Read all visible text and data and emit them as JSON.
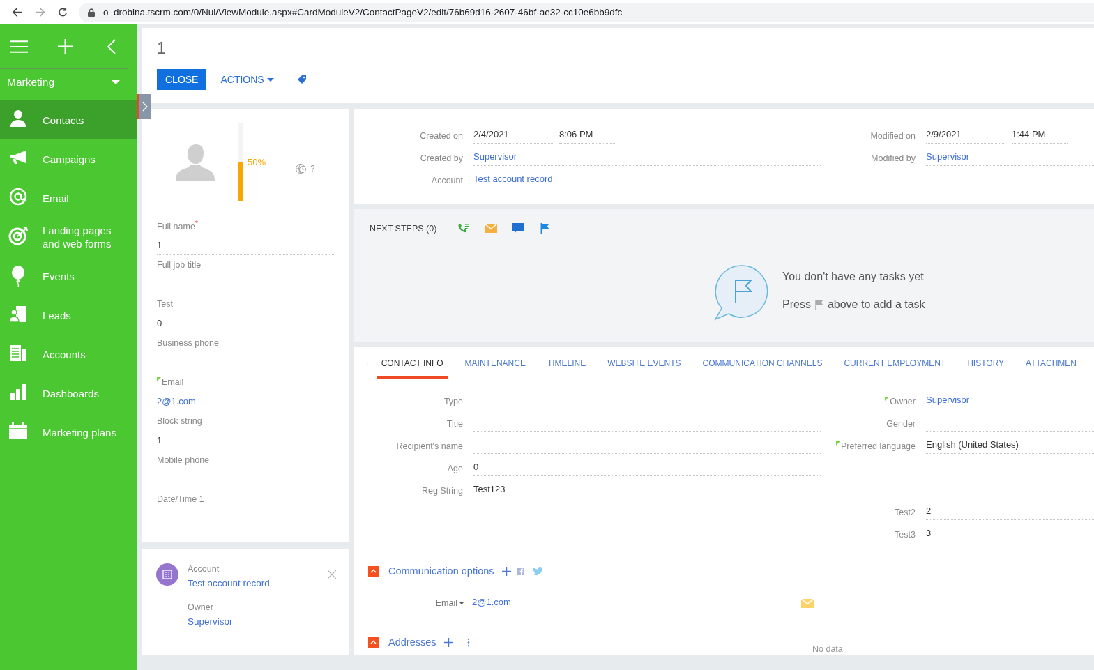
{
  "browser": {
    "url": "o_drobina.tscrm.com/0/Nui/ViewModule.aspx#CardModuleV2/ContactPageV2/edit/76b69d16-2607-46bf-ae32-cc10e6bb9dfc"
  },
  "sidebar": {
    "section": "Marketing",
    "items": [
      {
        "label": "Contacts",
        "selected": true
      },
      {
        "label": "Campaigns",
        "selected": false
      },
      {
        "label": "Email",
        "selected": false
      },
      {
        "label": "Landing pages and web forms",
        "selected": false
      },
      {
        "label": "Events",
        "selected": false
      },
      {
        "label": "Leads",
        "selected": false
      },
      {
        "label": "Accounts",
        "selected": false
      },
      {
        "label": "Dashboards",
        "selected": false
      },
      {
        "label": "Marketing plans",
        "selected": false
      }
    ]
  },
  "header": {
    "title": "1",
    "close": "CLOSE",
    "actions": "ACTIONS"
  },
  "profile": {
    "completeness": {
      "level": 0.5,
      "text": "50%"
    },
    "timezone": "?",
    "fields": [
      {
        "label": "Full name",
        "required_mark": "*",
        "value": "1",
        "kind": "text",
        "marked": false
      },
      {
        "label": "Full job title",
        "kind": "text",
        "marked": false
      },
      {
        "label": "Test",
        "value": "0",
        "kind": "text",
        "marked": false
      },
      {
        "label": "Business phone",
        "kind": "text",
        "marked": false
      },
      {
        "label": "Email",
        "value": "2@1.com",
        "kind": "link",
        "marked": true
      },
      {
        "label": "Block string",
        "value": "1",
        "kind": "text",
        "marked": false
      },
      {
        "label": "Mobile phone",
        "kind": "text",
        "marked": false
      },
      {
        "label": "Date/Time 1",
        "kind": "datetime",
        "marked": false
      }
    ]
  },
  "account_card": {
    "label": "Account",
    "value": "Test account record",
    "owner_label": "Owner",
    "owner": "Supervisor"
  },
  "record_info": {
    "left": [
      {
        "label": "Created on",
        "kind": "datetime",
        "values": [
          "2/4/2021",
          "8:06 PM"
        ]
      },
      {
        "label": "Created by",
        "kind": "link",
        "values": [
          "Supervisor"
        ]
      },
      {
        "label": "Account",
        "kind": "link",
        "values": [
          "Test account record"
        ]
      }
    ],
    "right": [
      {
        "label": "Modified on",
        "kind": "datetime",
        "values": [
          "2/9/2021",
          "1:44 PM"
        ]
      },
      {
        "label": "Modified by",
        "kind": "link",
        "values": [
          "Supervisor"
        ]
      }
    ]
  },
  "next_steps": {
    "title": "NEXT STEPS (0)",
    "empty_title": "You don't have any tasks yet",
    "hint_before": "Press",
    "hint_after": "above to add a task"
  },
  "tabs": [
    {
      "label": "CONTACT INFO",
      "selected": true
    },
    {
      "label": "MAINTENANCE",
      "selected": false
    },
    {
      "label": "TIMELINE",
      "selected": false
    },
    {
      "label": "WEBSITE EVENTS",
      "selected": false
    },
    {
      "label": "COMMUNICATION CHANNELS",
      "selected": false
    },
    {
      "label": "CURRENT EMPLOYMENT",
      "selected": false
    },
    {
      "label": "HISTORY",
      "selected": false
    },
    {
      "label": "ATTACHMEN",
      "selected": false
    }
  ],
  "contact_info": {
    "left": [
      {
        "label": "Type",
        "kind": "text",
        "marked": false
      },
      {
        "label": "Title",
        "kind": "text",
        "marked": false
      },
      {
        "label": "Recipient's name",
        "kind": "text",
        "marked": false
      },
      {
        "label": "Age",
        "value": "0",
        "kind": "text",
        "marked": false
      },
      {
        "label": "Reg String",
        "value": "Test123",
        "kind": "text",
        "marked": false
      }
    ],
    "right_groups": [
      [
        {
          "label": "Owner",
          "value": "Supervisor",
          "kind": "link",
          "marked": true
        },
        {
          "label": "Gender",
          "kind": "text",
          "marked": false
        },
        {
          "label": "Preferred language",
          "value": "English (United States)",
          "kind": "text",
          "marked": true
        }
      ],
      [
        {
          "label": "Test2",
          "value": "2",
          "kind": "text",
          "marked": false
        },
        {
          "label": "Test3",
          "value": "3",
          "kind": "text",
          "marked": false
        }
      ]
    ]
  },
  "communication": {
    "title": "Communication options",
    "expanded": true,
    "email_type": "Email",
    "email": "2@1.com"
  },
  "addresses": {
    "title": "Addresses",
    "expanded": true,
    "empty": "No data"
  }
}
